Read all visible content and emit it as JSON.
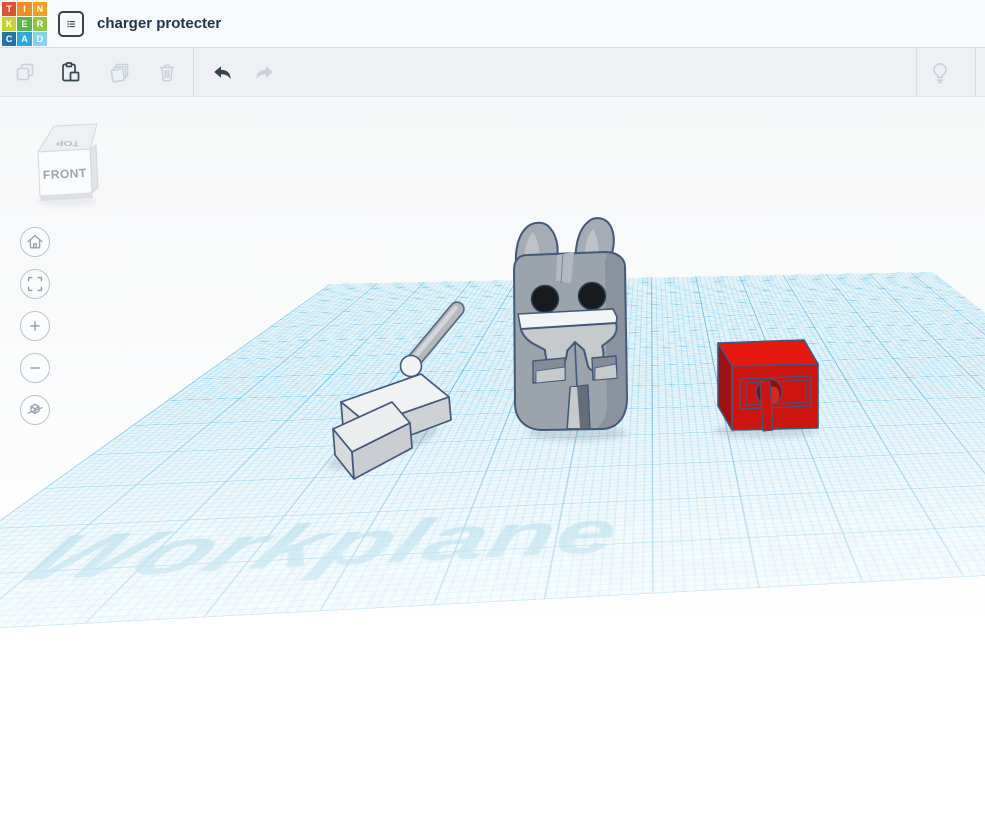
{
  "topbar": {
    "logo_cells": [
      {
        "ch": "T",
        "color": "#e2502d"
      },
      {
        "ch": "I",
        "color": "#f68b1f"
      },
      {
        "ch": "N",
        "color": "#f9a01b"
      },
      {
        "ch": "K",
        "color": "#c8d22b"
      },
      {
        "ch": "E",
        "color": "#57b947"
      },
      {
        "ch": "R",
        "color": "#8dc63f"
      },
      {
        "ch": "C",
        "color": "#1f74b9"
      },
      {
        "ch": "A",
        "color": "#2aa9e0"
      },
      {
        "ch": "D",
        "color": "#7ed3f7"
      }
    ],
    "title": "charger protecter"
  },
  "toolbar": {
    "tools": [
      {
        "id": "copy",
        "enabled": false
      },
      {
        "id": "paste",
        "enabled": true
      },
      {
        "id": "duplicate",
        "enabled": false
      },
      {
        "id": "delete",
        "enabled": false
      },
      {
        "id": "undo",
        "enabled": true
      },
      {
        "id": "redo",
        "enabled": false
      },
      {
        "id": "tips",
        "enabled": false
      },
      {
        "id": "comments",
        "enabled": false
      }
    ]
  },
  "viewcube": {
    "top_label": "TOP",
    "front_label": "FRONT"
  },
  "view_nav": {
    "buttons": [
      "home-view",
      "fit-view",
      "zoom-in",
      "zoom-out",
      "switch-projection"
    ]
  },
  "workplane": {
    "label": "Workplane"
  },
  "scene": {
    "objects": [
      "usb-cable-connector",
      "gray-dog-figure",
      "red-holder-box"
    ]
  },
  "colors": {
    "outline": "#42587a",
    "topbar-bg": "#f8f9fb",
    "topbar-border": "#d8dde3",
    "title-color": "#21364b",
    "toolbar-bg": "#eef0f3",
    "toolbar-border": "#e1e4e9",
    "icon-dark": "#36444d",
    "icon-disabled": "#c8d2dd",
    "divider": "#d9dde2",
    "canvas-top": "#f6f7f8",
    "nav-ring": "#bac3cf",
    "nav-glyph": "#95a1b2",
    "plane-base": "#e2f3fa",
    "grid-major": "rgba(46,163,207,0.75)",
    "grid-minor": "rgba(86,190,224,0.38)",
    "wp-text": "rgba(108,189,221,0.62)",
    "dog-gray": "#9ba3ac",
    "dog-light": "#c6cacd",
    "dog-lighter": "#bcc2c8",
    "dog-ear": "#a5acb5",
    "dog-window": "#848d97",
    "dog-slot": "#646e7a",
    "dog-eye": "#171a1e",
    "dog-white": "#f3f4f5",
    "dog-side": "rgba(105,115,128,0.35)",
    "dog-head-top": "#b3b9c1",
    "usb-top": "#f1f2f3",
    "usb-left": "#dddfe2",
    "usb-right": "#cfd2d5",
    "tip-top": "#ebedee",
    "tip-left": "#d8dbdd",
    "tip-front": "#c9ccd0",
    "cable": "#b4b9be",
    "cable-edge": "#5d6b80",
    "cable-hi": "#d2d5d9",
    "sphere": "#f2f3f4",
    "red-top": "#e81710",
    "red-front": "#cd1410",
    "red-left": "#a01010",
    "red-hole": "#8e0e0c",
    "red-hi": "#cf2b23",
    "cube-top": "#eef1f3",
    "cube-front": "#fafbfc",
    "cube-right": "#e2e5e8",
    "cube-edge": "#d3d7db",
    "cube-text": "#9aa2ac",
    "cube-text-top": "#b6bcc4",
    "shadow": "rgba(130,145,160,0.28)"
  }
}
